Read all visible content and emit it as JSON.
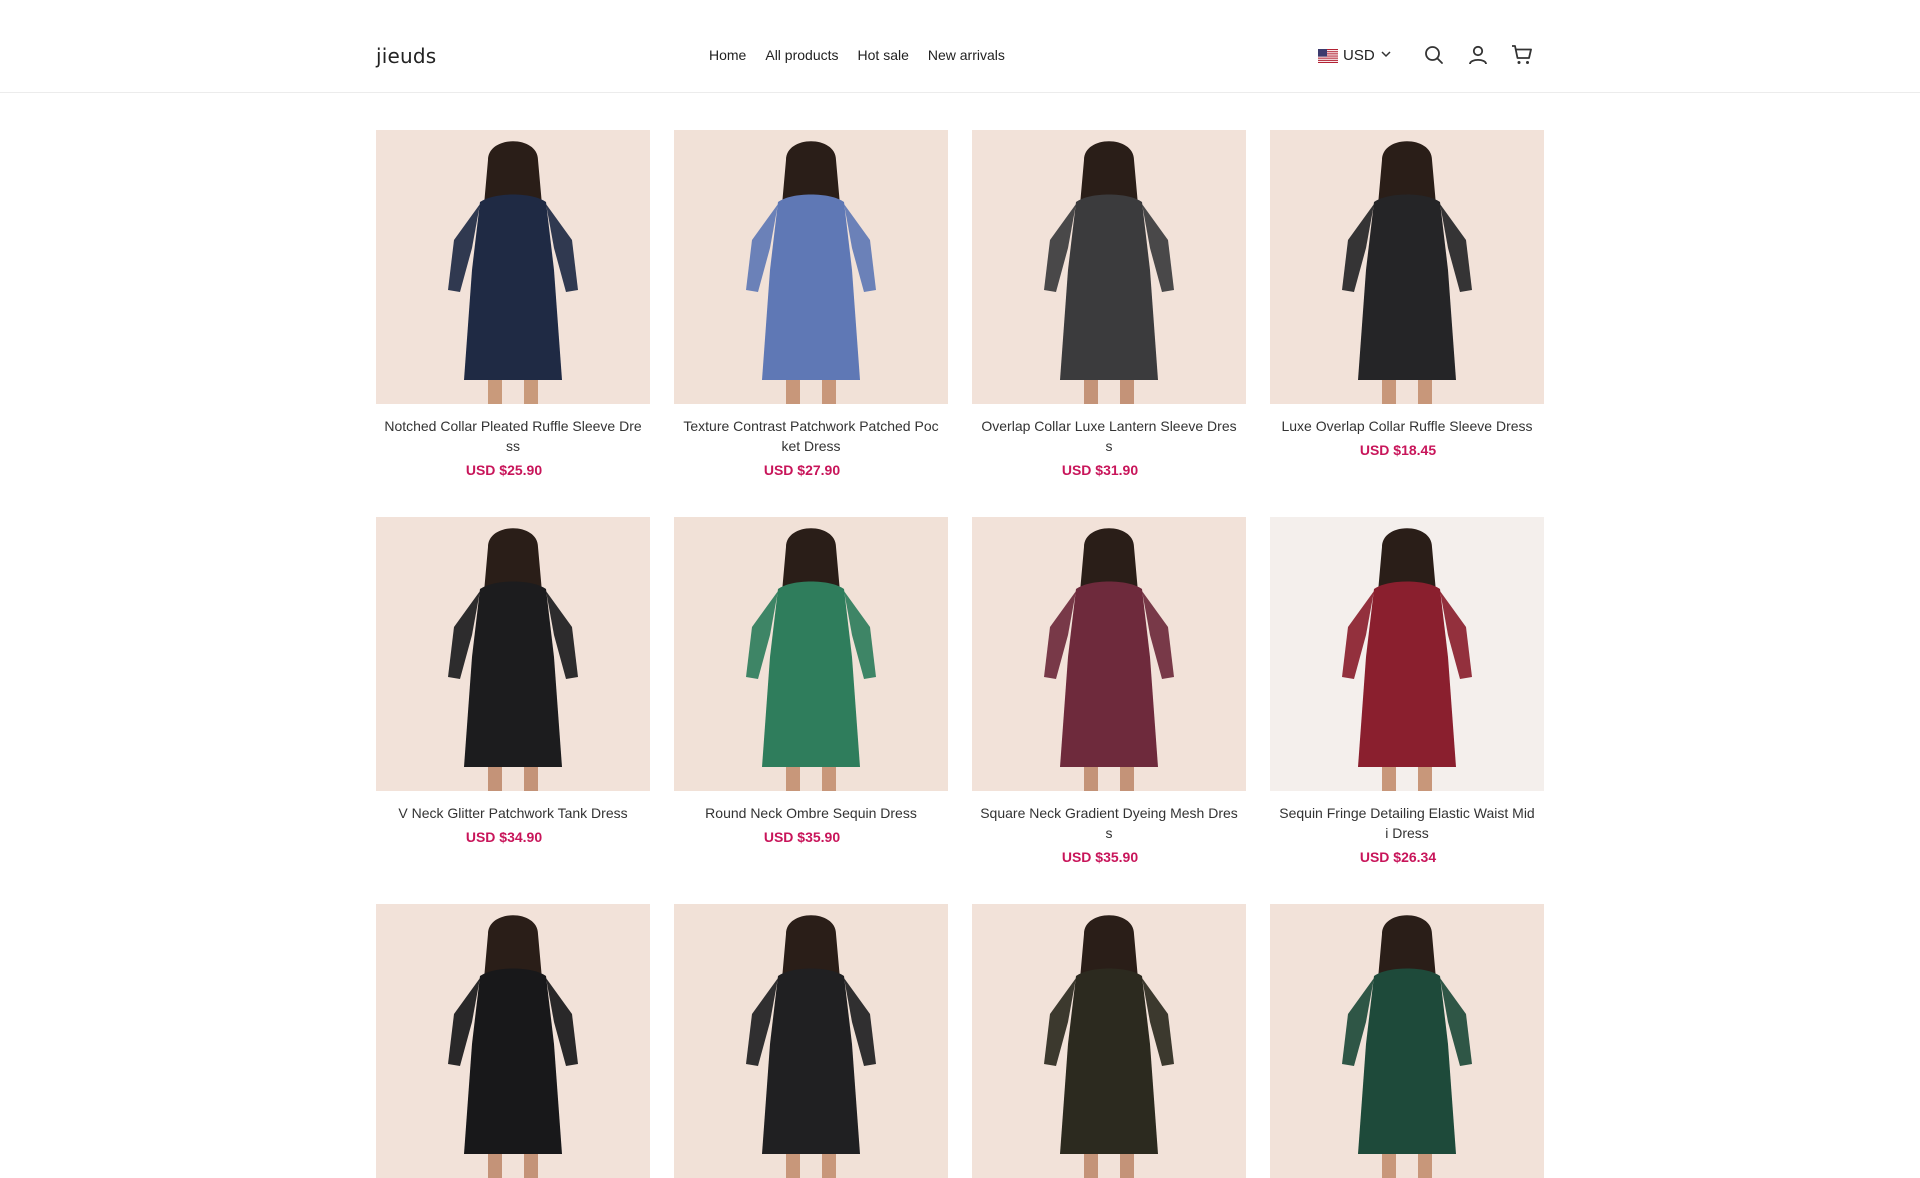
{
  "header": {
    "logo": "jieuds",
    "nav": [
      {
        "label": "Home"
      },
      {
        "label": "All products"
      },
      {
        "label": "Hot sale"
      },
      {
        "label": "New arrivals"
      }
    ],
    "currency": "USD"
  },
  "products": [
    {
      "title": "Notched Collar Pleated Ruffle Sleeve Dress",
      "price": "USD $25.90",
      "bg": "#f2e2d9",
      "dress": "#1f2a44",
      "skin": "#c99a7b"
    },
    {
      "title": "Texture Contrast Patchwork Patched Pocket Dress",
      "price": "USD $27.90",
      "bg": "#f1e1d7",
      "dress": "#5f78b5",
      "skin": "#c8977a"
    },
    {
      "title": "Overlap Collar Luxe Lantern Sleeve Dress",
      "price": "USD $31.90",
      "bg": "#f2e2d9",
      "dress": "#3b3b3d",
      "skin": "#c49378"
    },
    {
      "title": "Luxe Overlap Collar Ruffle Sleeve Dress",
      "price": "USD $18.45",
      "bg": "#f2e2d9",
      "dress": "#252527",
      "skin": "#c8977a"
    },
    {
      "title": "V Neck Glitter Patchwork Tank Dress",
      "price": "USD $34.90",
      "bg": "#f2e2d9",
      "dress": "#1c1c1e",
      "skin": "#c49378"
    },
    {
      "title": "Round Neck Ombre Sequin Dress",
      "price": "USD $35.90",
      "bg": "#f1e1d7",
      "dress": "#2f7d5c",
      "skin": "#c8977a"
    },
    {
      "title": "Square Neck Gradient Dyeing Mesh Dress",
      "price": "USD $35.90",
      "bg": "#f2e2d9",
      "dress": "#6e2a3c",
      "skin": "#c49378"
    },
    {
      "title": "Sequin Fringe Detailing Elastic Waist Midi Dress",
      "price": "USD $26.34",
      "bg": "#f4efec",
      "dress": "#8a1f2e",
      "skin": "#c8977a"
    },
    {
      "title": "",
      "price": "",
      "bg": "#f2e2d9",
      "dress": "#18181a",
      "skin": "#c49378"
    },
    {
      "title": "",
      "price": "",
      "bg": "#f1e1d7",
      "dress": "#202022",
      "skin": "#c8977a"
    },
    {
      "title": "",
      "price": "",
      "bg": "#f2e2d9",
      "dress": "#2c2a1f",
      "skin": "#c49378"
    },
    {
      "title": "",
      "price": "",
      "bg": "#f2e2d9",
      "dress": "#1e4a3a",
      "skin": "#c8977a"
    }
  ],
  "colors": {
    "price": "#c8155a",
    "text": "#222222",
    "border": "#ececec"
  }
}
